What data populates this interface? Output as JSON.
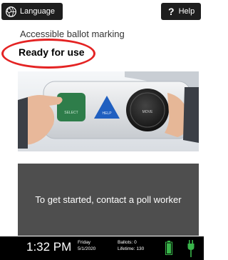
{
  "topbar": {
    "language_label": "Language",
    "help_glyph": "?",
    "help_label": "Help"
  },
  "main": {
    "subtitle": "Accessible ballot marking",
    "status": "Ready for use",
    "photo_labels": {
      "select": "SELECT",
      "help": "HELP",
      "move": "MOVE"
    },
    "message": "To get started, contact a poll worker"
  },
  "statusbar": {
    "time": "1:32 PM",
    "day": "Friday",
    "date": "5/1/2020",
    "ballots_label": "Ballots:",
    "ballots_value": "0",
    "lifetime_label": "Lifetime:",
    "lifetime_value": "130"
  },
  "icons": {
    "language": "globe-speech-icon",
    "help": "question-mark-icon",
    "battery": "battery-full-icon",
    "power": "power-plug-icon"
  },
  "colors": {
    "dark_button": "#1e1e1e",
    "annotation_ring": "#e42323",
    "message_panel": "#4e4e4e",
    "status_bar": "#000000",
    "battery_green": "#39b54a",
    "select_button": "#2e7d4a",
    "help_button": "#1f5fc0",
    "move_dial": "#222222"
  }
}
